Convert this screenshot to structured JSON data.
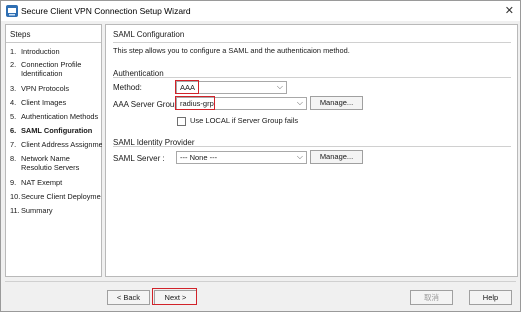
{
  "window": {
    "title": "Secure Client VPN Connection Setup Wizard",
    "close_glyph": "✕",
    "app_icon": "cisco-asdm-icon"
  },
  "steps": {
    "title": "Steps",
    "items": [
      {
        "num": "1.",
        "label": "Introduction"
      },
      {
        "num": "2.",
        "label": "Connection Profile Identification"
      },
      {
        "num": "3.",
        "label": "VPN Protocols"
      },
      {
        "num": "4.",
        "label": "Client Images"
      },
      {
        "num": "5.",
        "label": "Authentication Methods"
      },
      {
        "num": "6.",
        "label": "SAML Configuration",
        "active": true
      },
      {
        "num": "7.",
        "label": "Client Address Assignme"
      },
      {
        "num": "8.",
        "label": "Network Name Resolutio Servers"
      },
      {
        "num": "9.",
        "label": "NAT Exempt"
      },
      {
        "num": "10.",
        "label": "Secure Client Deployme"
      },
      {
        "num": "11.",
        "label": "Summary"
      }
    ]
  },
  "saml": {
    "heading": "SAML Configuration",
    "description": "This step allows you to configure a SAML and the authenticaion method.",
    "auth_section": "Authentication",
    "method_label": "Method:",
    "method_value": "AAA",
    "aaa_group_label": "AAA Server Group:",
    "aaa_group_value": "radius-grp",
    "manage_label": "Manage...",
    "use_local_label": "Use LOCAL if Server Group fails",
    "use_local_checked": false,
    "idp_section": "SAML Identity Provider",
    "saml_server_label": "SAML Server :",
    "saml_server_value": "--- None ---",
    "manage2_label": "Manage..."
  },
  "footer": {
    "back_label": "< Back",
    "next_label": "Next >",
    "cancel_label": "取消",
    "help_label": "Help"
  },
  "colors": {
    "highlight": "#d1232a"
  }
}
